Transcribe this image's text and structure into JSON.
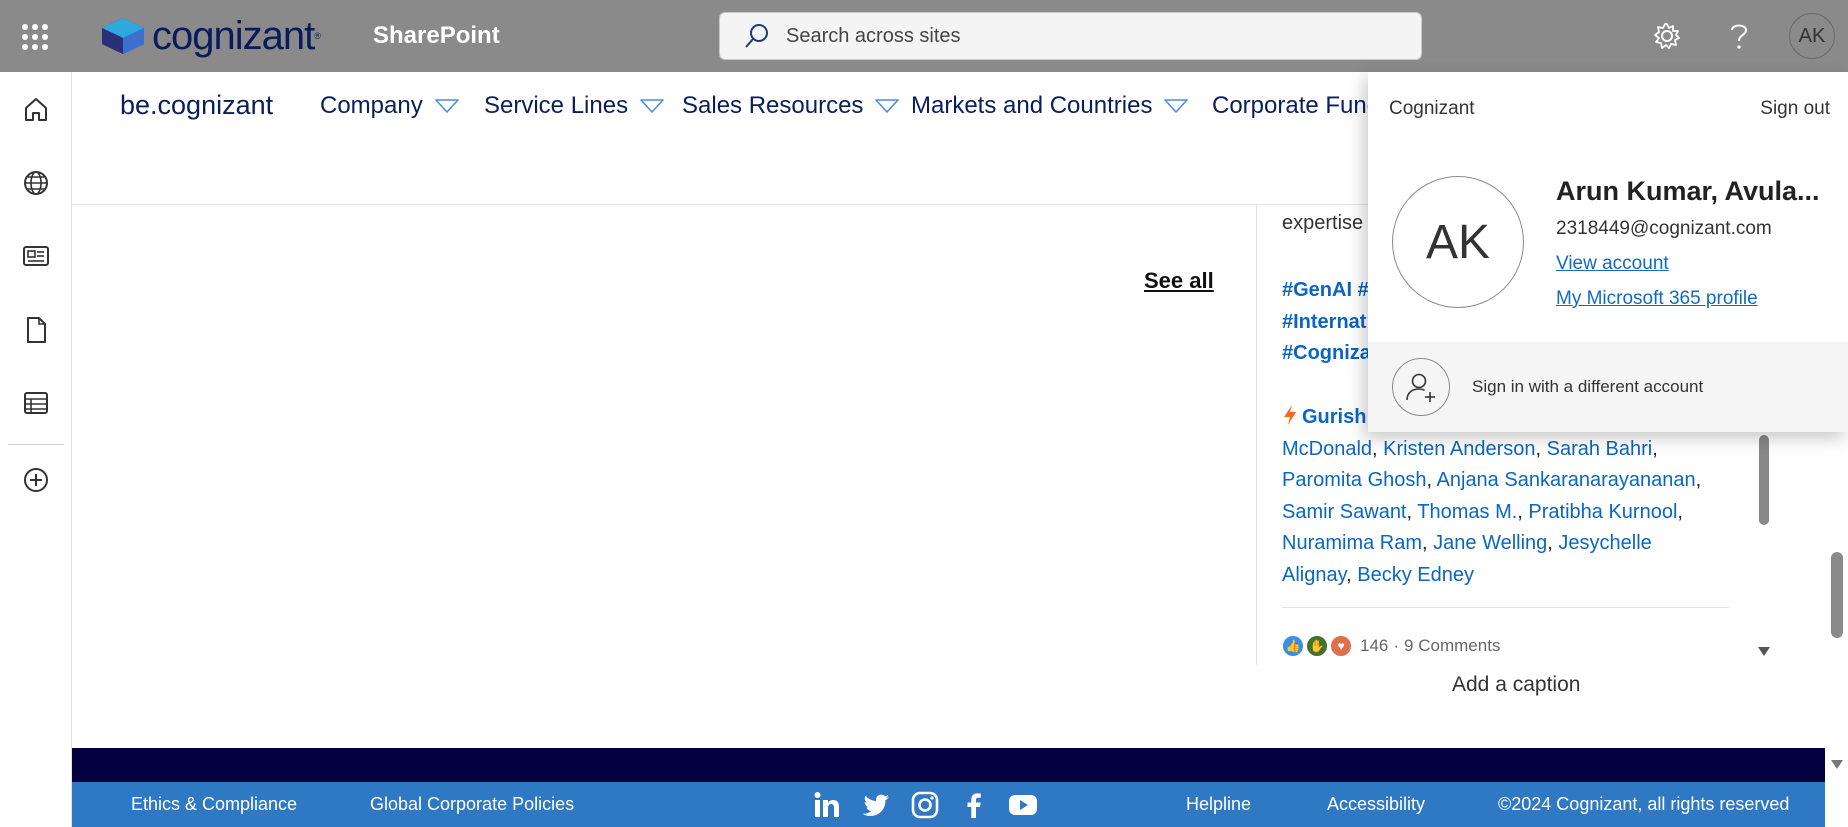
{
  "suitebar": {
    "logo_text": "cognizant",
    "logo_tm": "®",
    "app_title": "SharePoint",
    "search_placeholder": "Search across sites",
    "avatar_initials": "AK"
  },
  "hubnav": {
    "site_title": "be.cognizant",
    "items": [
      {
        "label": "Company"
      },
      {
        "label": "Service Lines"
      },
      {
        "label": "Sales Resources"
      },
      {
        "label": "Markets and Countries"
      },
      {
        "label": "Corporate Func"
      }
    ]
  },
  "main": {
    "see_all_label": "See all"
  },
  "post": {
    "text_top": "expertise",
    "tags": [
      "#GenAI",
      "#",
      "#Internat",
      "#Cognizа"
    ],
    "lead_mention": "Gurish",
    "mentions": [
      "McDonald",
      "Kristen Anderson",
      "Sarah Bahri",
      "Paromita Ghosh",
      "Anjana Sankaranarayananan",
      "Samir Sawant",
      "Thomas M.",
      "Pratibha Kurnool",
      "Nuramima Ram",
      "Jane Welling",
      "Jesychelle",
      "Alignay",
      "Becky Edney"
    ],
    "reactions_count": "146",
    "comments": "9 Comments",
    "caption_placeholder": "Add a caption"
  },
  "footer": {
    "links": [
      "Ethics & Compliance",
      "Global Corporate Policies",
      "Helpline",
      "Accessibility"
    ],
    "copyright": "©2024 Cognizant, all rights reserved",
    "social": [
      "linkedin-icon",
      "twitter-icon",
      "instagram-icon",
      "facebook-icon",
      "youtube-icon"
    ]
  },
  "flyout": {
    "org": "Cognizant",
    "sign_out": "Sign out",
    "initials": "AK",
    "name": "Arun Kumar, Avula...",
    "email": "2318449@cognizant.com",
    "view_account": "View account",
    "m365_profile": "My Microsoft 365 profile",
    "switch_account": "Sign in with a different account"
  },
  "colors": {
    "suitebar": "#8a8a8a",
    "nav_text": "#0b1e5b",
    "link": "#0a66c2",
    "footer_dark": "#03003f",
    "footer_blue": "#2f78c4"
  }
}
